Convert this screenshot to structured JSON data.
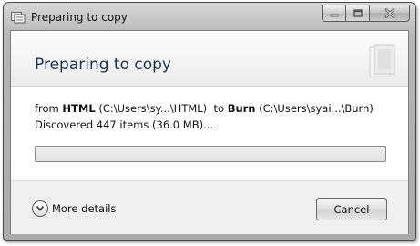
{
  "window": {
    "title": "Preparing to copy",
    "titlebar_icon": "copy-folder-icon",
    "controls": {
      "minimize_icon": "minimize-icon",
      "maximize_icon": "maximize-icon",
      "close_icon": "close-icon"
    }
  },
  "dialog": {
    "heading": "Preparing to copy",
    "from_prefix": "from ",
    "source_name": "HTML",
    "source_path": " (C:\\Users\\sy...\\HTML)",
    "to_prefix": "  to ",
    "dest_name": "Burn",
    "dest_path": " (C:\\Users\\syai...\\Burn)",
    "status": "Discovered 447 items (36.0 MB)...",
    "progress_fraction": 0.0
  },
  "footer": {
    "more_details_label": "More details",
    "more_details_icon": "chevron-down-icon",
    "cancel_label": "Cancel"
  },
  "colors": {
    "heading_text": "#1c2f4e",
    "window_frame": "#b6b6b6",
    "footer_bg": "#f0f0f0"
  }
}
